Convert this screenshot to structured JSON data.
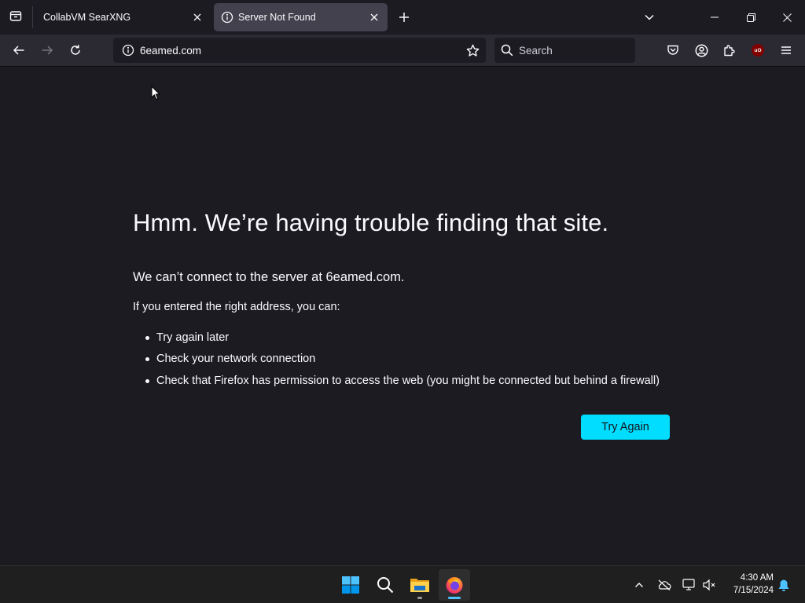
{
  "tabs": [
    {
      "title": "CollabVM SearXNG",
      "active": false
    },
    {
      "title": "Server Not Found",
      "active": true
    }
  ],
  "navbar": {
    "url": "6eamed.com",
    "search_placeholder": "Search"
  },
  "error_page": {
    "title": "Hmm. We’re having trouble finding that site.",
    "short_desc": "We can’t connect to the server at 6eamed.com.",
    "intro": "If you entered the right address, you can:",
    "suggestions": [
      "Try again later",
      "Check your network connection",
      "Check that Firefox has permission to access the web (you might be connected but behind a firewall)"
    ],
    "try_again_label": "Try Again"
  },
  "taskbar": {
    "time": "4:30 AM",
    "date": "7/15/2024"
  },
  "colors": {
    "accent": "#00ddff",
    "page_bg": "#1c1b22",
    "toolbar_bg": "#2b2a33",
    "active_tab_bg": "#42414d",
    "ublock_red": "#800000"
  }
}
